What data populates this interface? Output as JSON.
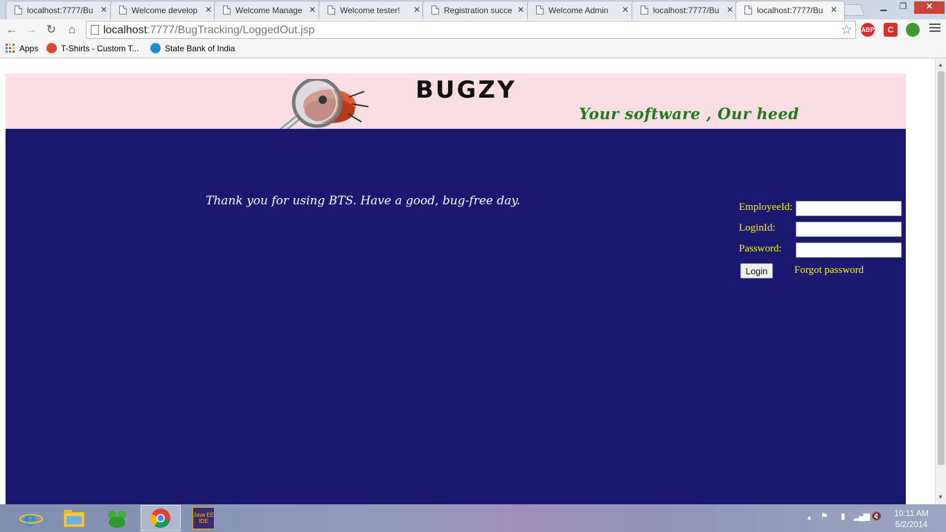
{
  "browser": {
    "tabs": [
      {
        "title": "localhost:7777/Bu",
        "active": false
      },
      {
        "title": "Welcome develop",
        "active": false
      },
      {
        "title": "Welcome Manage",
        "active": false
      },
      {
        "title": "Welcome tester!",
        "active": false
      },
      {
        "title": "Registration succe",
        "active": false
      },
      {
        "title": "Welcome Admin",
        "active": false
      },
      {
        "title": "localhost:7777/Bu",
        "active": false
      },
      {
        "title": "localhost:7777/Bu",
        "active": true
      }
    ],
    "url_host": "localhost",
    "url_rest": ":7777/BugTracking/LoggedOut.jsp",
    "extensions": [
      "ABP",
      "C"
    ],
    "bookmarks": {
      "apps": "Apps",
      "tshirts": "T-Shirts - Custom T...",
      "sbi": "State Bank of India"
    }
  },
  "page": {
    "brand": "BUGZY",
    "tagline": "Your software , Our heed",
    "message": "Thank you for using BTS. Have a good, bug-free day.",
    "login": {
      "employee_label": "EmployeeId:",
      "login_label": "LoginId:",
      "password_label": "Password:",
      "employee_value": "",
      "login_value": "",
      "password_value": "",
      "login_button": "Login",
      "forgot_link": "Forgot password"
    },
    "colors": {
      "banner": "#f9dfe4",
      "main_bg": "#1b186f",
      "label": "#f5f500",
      "tagline": "#1f7a1f"
    }
  },
  "taskbar": {
    "apps": [
      "internet-explorer",
      "file-explorer",
      "green-app",
      "chrome",
      "java-ee-ide"
    ],
    "java_label": "Java EE IDE",
    "time": "10:11 AM",
    "date": "5/2/2014"
  }
}
